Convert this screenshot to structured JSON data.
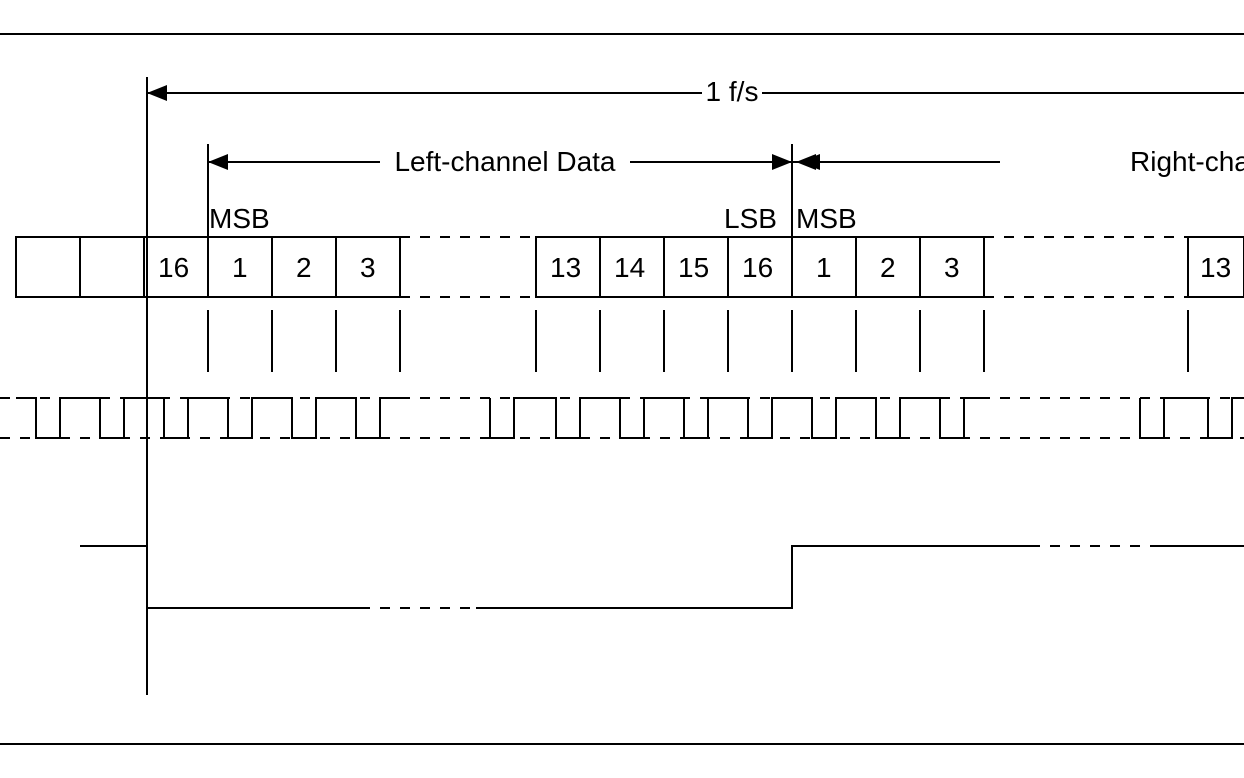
{
  "labels": {
    "frame_period": "1 f/s",
    "left_channel": "Left-channel Data",
    "right_channel": "Right-channel Da",
    "msb1": "MSB",
    "lsb": "LSB",
    "msb2": "MSB"
  },
  "cells": {
    "c1": "16",
    "c2": "1",
    "c3": "2",
    "c4": "3",
    "c5": "13",
    "c6": "14",
    "c7": "15",
    "c8": "16",
    "c9": "1",
    "c10": "2",
    "c11": "3",
    "c12": "13"
  }
}
